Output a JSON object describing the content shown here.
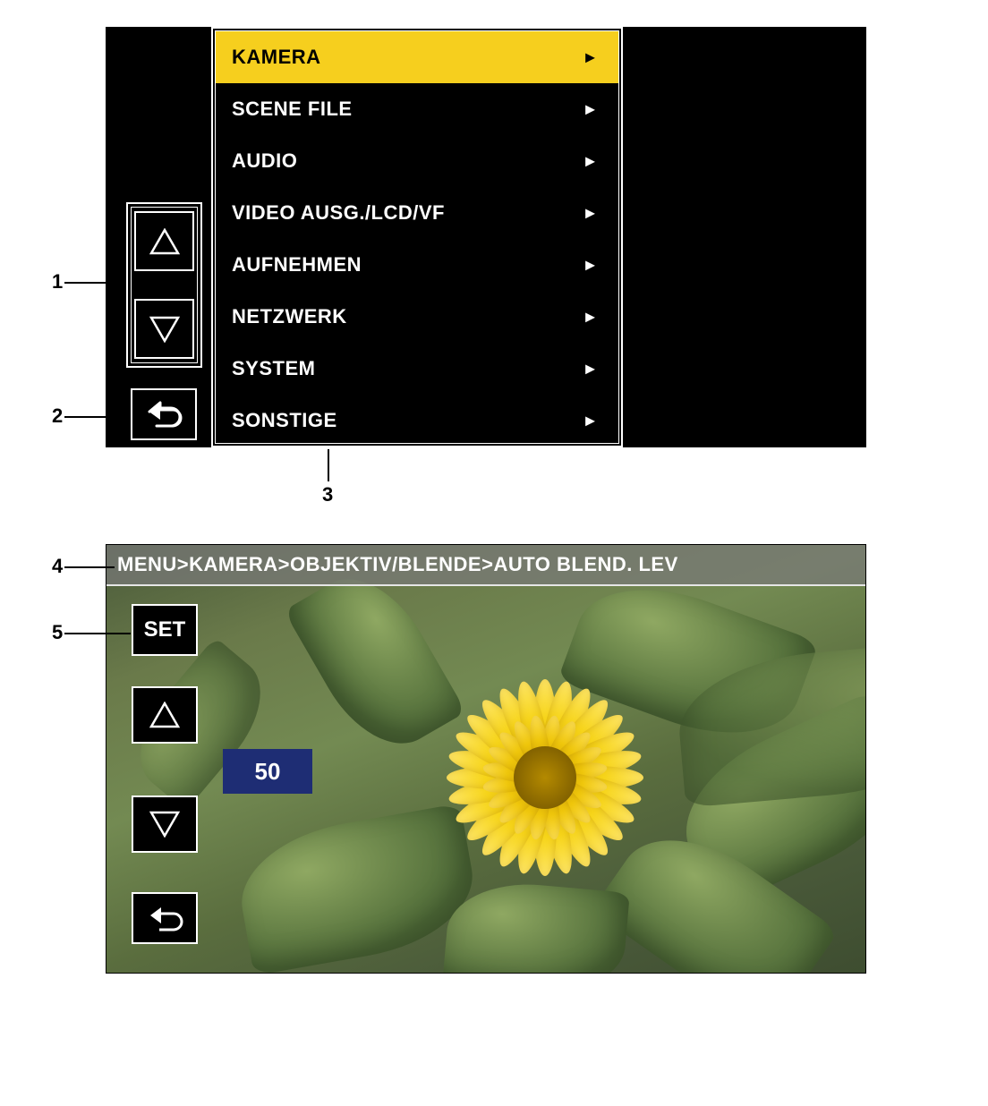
{
  "callouts": {
    "c1": "1",
    "c2": "2",
    "c3": "3",
    "c4": "4",
    "c5": "5"
  },
  "screen1": {
    "icons": {
      "up": "triangle-up-icon",
      "down": "triangle-down-icon",
      "back": "return-icon"
    },
    "menu": {
      "selected_index": 0,
      "items": [
        {
          "label": "KAMERA"
        },
        {
          "label": "SCENE FILE"
        },
        {
          "label": "AUDIO"
        },
        {
          "label": "VIDEO AUSG./LCD/VF"
        },
        {
          "label": "AUFNEHMEN"
        },
        {
          "label": "NETZWERK"
        },
        {
          "label": "SYSTEM"
        },
        {
          "label": "SONSTIGE"
        }
      ],
      "arrow_glyph": "►"
    }
  },
  "screen2": {
    "breadcrumb": "MENU>KAMERA>OBJEKTIV/BLENDE>AUTO BLEND. LEV",
    "set_label": "SET",
    "value": "50",
    "colors": {
      "value_box_bg": "#1e2d74"
    },
    "icons": {
      "up": "triangle-up-icon",
      "down": "triangle-down-icon",
      "back": "return-icon"
    }
  }
}
